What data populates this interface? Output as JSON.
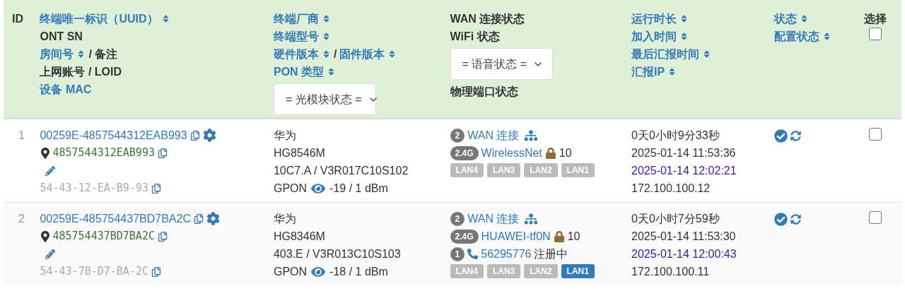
{
  "header": {
    "id_label": "ID",
    "columns": [
      {
        "lines": [
          {
            "kind": "text",
            "parts": [
              {
                "text": "终端唯一标识（UUID）",
                "link": true,
                "sortable": true
              }
            ]
          },
          {
            "kind": "text",
            "parts": [
              {
                "text": "ONT SN",
                "link": false,
                "sortable": false
              }
            ]
          },
          {
            "kind": "text",
            "parts": [
              {
                "text": "房间号",
                "link": true,
                "sortable": true
              },
              {
                "text": "/ 备注",
                "link": false,
                "sortable": false
              }
            ]
          },
          {
            "kind": "text",
            "parts": [
              {
                "text": "上网账号 / LOID",
                "link": false,
                "sortable": false
              }
            ]
          },
          {
            "kind": "text",
            "parts": [
              {
                "text": "设备 MAC",
                "link": true,
                "sortable": false
              }
            ]
          }
        ]
      },
      {
        "lines": [
          {
            "kind": "text",
            "parts": [
              {
                "text": "终端厂商",
                "link": true,
                "sortable": true
              }
            ]
          },
          {
            "kind": "text",
            "parts": [
              {
                "text": "终端型号",
                "link": true,
                "sortable": true
              }
            ]
          },
          {
            "kind": "text",
            "parts": [
              {
                "text": "硬件版本",
                "link": true,
                "sortable": true
              },
              {
                "text": "/",
                "link": false,
                "sortable": false
              },
              {
                "text": "固件版本",
                "link": true,
                "sortable": true
              }
            ]
          },
          {
            "kind": "text",
            "parts": [
              {
                "text": "PON 类型",
                "link": true,
                "sortable": true
              }
            ]
          },
          {
            "kind": "select",
            "value": "= 光模块状态 ="
          }
        ]
      },
      {
        "lines": [
          {
            "kind": "text",
            "parts": [
              {
                "text": "WAN 连接状态",
                "link": false,
                "sortable": false
              }
            ]
          },
          {
            "kind": "text",
            "parts": [
              {
                "text": "WiFi 状态",
                "link": false,
                "sortable": false
              }
            ]
          },
          {
            "kind": "select",
            "value": "= 语音状态 ="
          },
          {
            "kind": "text",
            "parts": [
              {
                "text": "物理端口状态",
                "link": false,
                "sortable": false
              }
            ]
          }
        ]
      },
      {
        "lines": [
          {
            "kind": "text",
            "parts": [
              {
                "text": "运行时长",
                "link": true,
                "sortable": true
              }
            ]
          },
          {
            "kind": "text",
            "parts": [
              {
                "text": "加入时间",
                "link": true,
                "sortable": true
              }
            ]
          },
          {
            "kind": "text",
            "parts": [
              {
                "text": "最后汇报时间",
                "link": true,
                "sortable": true
              }
            ]
          },
          {
            "kind": "text",
            "parts": [
              {
                "text": "汇报IP",
                "link": true,
                "sortable": true
              }
            ]
          }
        ]
      },
      {
        "lines": [
          {
            "kind": "text",
            "parts": [
              {
                "text": "状态",
                "link": true,
                "sortable": true
              }
            ]
          },
          {
            "kind": "text",
            "parts": [
              {
                "text": "配置状态",
                "link": true,
                "sortable": true
              }
            ]
          }
        ]
      }
    ],
    "select_label": "选择",
    "select_all": {
      "checked": false
    }
  },
  "rows": [
    {
      "id": "1",
      "uuid": "00259E-4857544312EAB993",
      "sn": "4857544312EAB993",
      "mac": "54-43-12-EA-B9-93",
      "vendor": "华为",
      "model": "HG8546M",
      "version": "10C7.A / V3R017C10S102",
      "pon": "GPON",
      "optical": "-19 / 1 dBm",
      "wan_count": "2",
      "wan_label": "WAN 连接",
      "wifi_band": "2.4G",
      "ssid": "WirelessNet",
      "wifi_count": "10",
      "lan_ports": [
        {
          "label": "LAN4",
          "up": false
        },
        {
          "label": "LAN3",
          "up": false
        },
        {
          "label": "LAN2",
          "up": false
        },
        {
          "label": "LAN1",
          "up": false
        }
      ],
      "uptime": "0天0小时9分33秒",
      "joined": "2025-01-14 11:53:36",
      "last_report": "2025-01-14 12:02:21",
      "ip": "172.100.100.12",
      "checked": false
    },
    {
      "id": "2",
      "uuid": "00259E-485754437BD7BA2C",
      "sn": "485754437BD7BA2C",
      "mac": "54-43-7B-D7-BA-2C",
      "vendor": "华为",
      "model": "HG8346M",
      "version": "403.E / V3R013C10S103",
      "pon": "GPON",
      "optical": "-18 / 1 dBm",
      "wan_count": "2",
      "wan_label": "WAN 连接",
      "wifi_band": "2.4G",
      "ssid": "HUAWEI-tf0N",
      "wifi_count": "10",
      "voice": {
        "count": "1",
        "number": "56295776",
        "status": "注册中"
      },
      "lan_ports": [
        {
          "label": "LAN4",
          "up": false
        },
        {
          "label": "LAN3",
          "up": false
        },
        {
          "label": "LAN2",
          "up": false
        },
        {
          "label": "LAN1",
          "up": true
        }
      ],
      "uptime": "0天0小时7分59秒",
      "joined": "2025-01-14 11:53:30",
      "last_report": "2025-01-14 12:00:43",
      "ip": "172.100.100.11",
      "checked": false
    }
  ]
}
